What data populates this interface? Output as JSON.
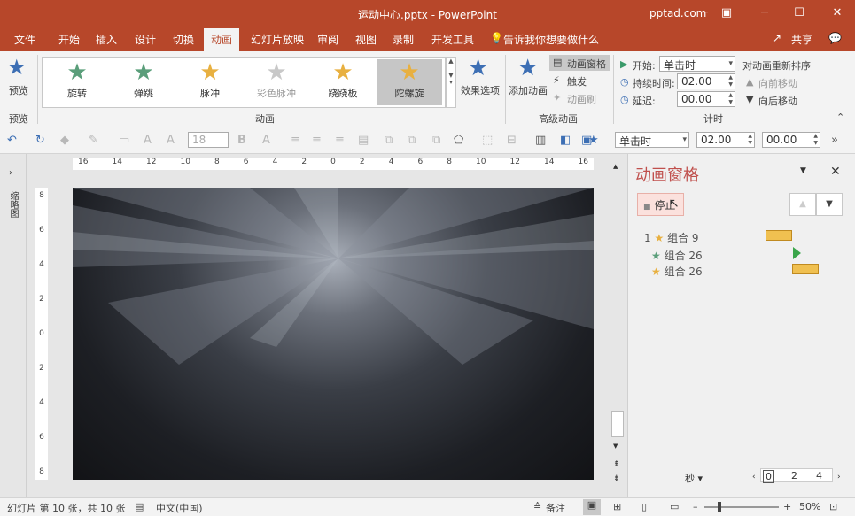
{
  "titlebar": {
    "title": "运动中心.pptx - PowerPoint",
    "account": "pptad.com",
    "minimize": "─",
    "restore": "☐",
    "close": "✕",
    "ribbon_display": "▣"
  },
  "menu": {
    "tabs": [
      "文件",
      "开始",
      "插入",
      "设计",
      "切换",
      "动画",
      "幻灯片放映",
      "审阅",
      "视图",
      "录制",
      "开发工具"
    ],
    "active": "动画",
    "tell_me": "告诉我你想要做什么",
    "share": "共享"
  },
  "ribbon": {
    "preview_label": "预览",
    "preview_group": "预览",
    "animation_group": "动画",
    "gallery": [
      {
        "label": "旋转",
        "color": "#5a9e7a"
      },
      {
        "label": "弹跳",
        "color": "#5a9e7a"
      },
      {
        "label": "脉冲",
        "color": "#e8b040"
      },
      {
        "label": "彩色脉冲",
        "color": "#c8c8c8"
      },
      {
        "label": "跷跷板",
        "color": "#e8b040"
      },
      {
        "label": "陀螺旋",
        "color": "#e8b040"
      }
    ],
    "gallery_selected": "陀螺旋",
    "effect_options": "效果选项",
    "add_animation": "添加动画",
    "anim_pane_btn": "动画窗格",
    "trigger": "触发",
    "anim_painter": "动画刷",
    "advanced_group": "高级动画",
    "start_label": "开始:",
    "start_value": "单击时",
    "duration_label": "持续时间:",
    "duration_value": "02.00",
    "delay_label": "延迟:",
    "delay_value": "00.00",
    "timing_group": "计时",
    "reorder_title": "对动画重新排序",
    "move_earlier": "向前移动",
    "move_later": "向后移动"
  },
  "quickbar": {
    "font_size": "18",
    "start_value": "单击时",
    "duration": "02.00",
    "delay": "00.00"
  },
  "ruler": {
    "h_labels": [
      "16",
      "14",
      "12",
      "10",
      "8",
      "6",
      "4",
      "2",
      "0",
      "2",
      "4",
      "6",
      "8",
      "10",
      "12",
      "14",
      "16"
    ],
    "v_labels": [
      "8",
      "6",
      "4",
      "2",
      "0",
      "2",
      "4",
      "6",
      "8"
    ]
  },
  "thumbs_label": "缩略图",
  "anim_pane": {
    "title": "动画窗格",
    "stop_button": "停止",
    "items": [
      {
        "index": "1",
        "name": "组合 9",
        "star_color": "#e8b040"
      },
      {
        "index": "",
        "name": "组合 26",
        "star_color": "#5a9e7a"
      },
      {
        "index": "",
        "name": "组合 26",
        "star_color": "#e8b040"
      }
    ],
    "seconds_label": "秒",
    "timeline_ticks": [
      "0",
      "2",
      "4"
    ]
  },
  "statusbar": {
    "slide_info": "幻灯片 第 10 张，共 10 张",
    "language": "中文(中国)",
    "notes": "备注",
    "zoom": "50%"
  }
}
